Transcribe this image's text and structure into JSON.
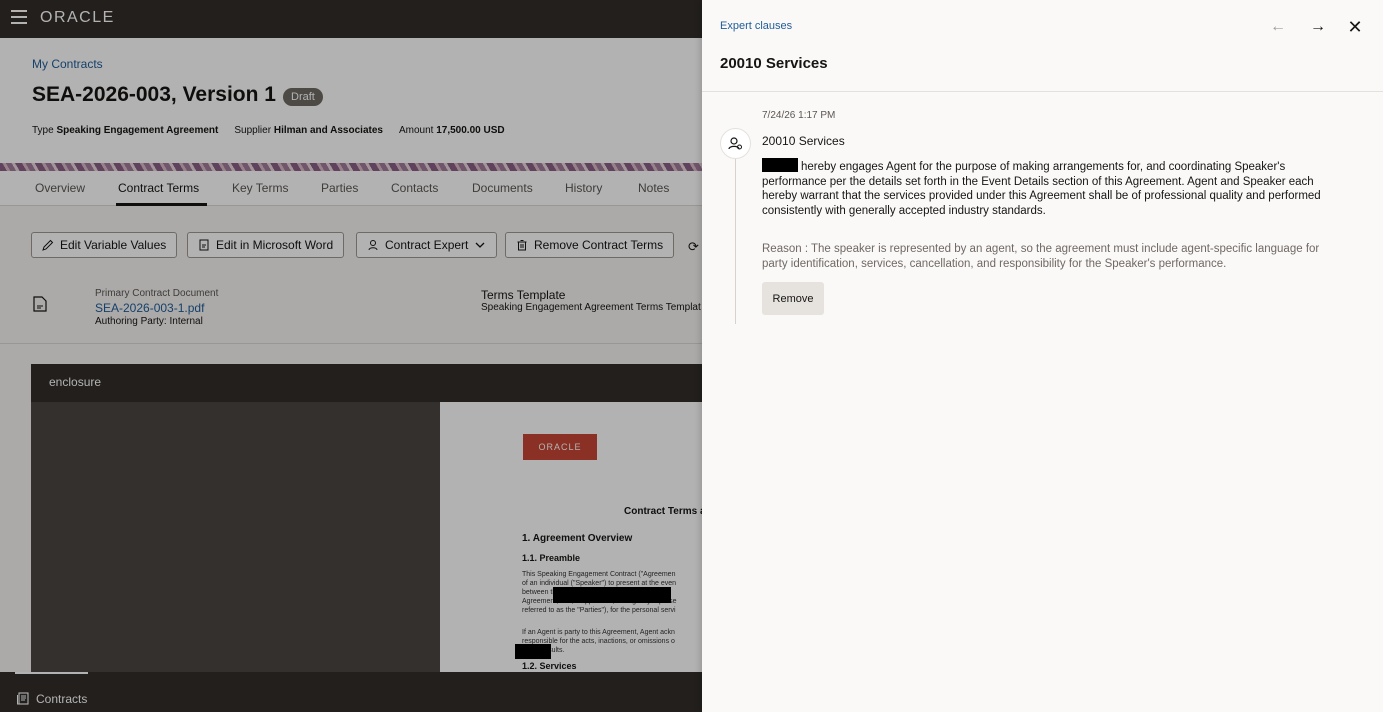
{
  "topbar": {
    "logo": "ORACLE"
  },
  "header": {
    "breadcrumb": "My Contracts",
    "title": "SEA-2026-003, Version 1",
    "status": "Draft",
    "meta": {
      "type_label": "Type",
      "type_value": "Speaking Engagement Agreement",
      "supplier_label": "Supplier",
      "supplier_value": "Hilman and Associates",
      "amount_label": "Amount",
      "amount_value": "17,500.00 USD"
    }
  },
  "tabs": [
    {
      "label": "Overview"
    },
    {
      "label": "Contract Terms",
      "active": true
    },
    {
      "label": "Key Terms"
    },
    {
      "label": "Parties"
    },
    {
      "label": "Contacts"
    },
    {
      "label": "Documents"
    },
    {
      "label": "History"
    },
    {
      "label": "Notes"
    }
  ],
  "toolbar": {
    "edit_variables": "Edit Variable Values",
    "edit_word": "Edit in Microsoft Word",
    "contract_expert": "Contract Expert",
    "remove_terms": "Remove Contract Terms"
  },
  "document": {
    "primary_label": "Primary Contract Document",
    "file_name": "SEA-2026-003-1.pdf",
    "authoring": "Authoring Party: Internal",
    "template_label": "Terms Template",
    "template_value": "Speaking Engagement Agreement Terms Templat"
  },
  "viewer": {
    "title": "enclosure",
    "logo": "ORACLE",
    "heading": "Contract Terms a",
    "section1": "1. Agreement Overview",
    "section1_1": "1.1. Preamble",
    "para1": [
      "This Speaking Engagement Contract (\"Agreemen",
      "of an individual (\"Speaker\") to present at the even",
      "between                                          the indiv",
      "Agreement, and, if applicable, the agency represe",
      "referred to as the \"Parties\"), for the personal servi"
    ],
    "para2": [
      "If an Agent is party to this Agreement, Agent ackn",
      "responsible for the acts, inactions, or omissions o",
      "              which results."
    ],
    "section1_2": "1.2. Services"
  },
  "bottom_bar": {
    "label": "Contracts"
  },
  "drawer": {
    "subtitle": "Expert clauses",
    "title": "20010 Services",
    "timestamp": "7/24/26 1:17 PM",
    "clause_title": "20010 Services",
    "clause_body": "hereby engages Agent for the purpose of making arrangements for, and coordinating Speaker's performance per the details set forth in the Event Details section of this Agreement. Agent and Speaker each hereby warrant that the services provided under this Agreement shall be of professional quality and performed consistently with generally accepted industry standards.",
    "reason": "Reason : The speaker is represented by an agent, so the agreement must include agent-specific language for party identification, services, cancellation, and responsibility for the Speaker's performance.",
    "remove_label": "Remove"
  },
  "icons": {
    "prev": "arrow-left-icon",
    "next": "arrow-right-icon",
    "close": "close-icon",
    "avatar": "expert-icon"
  },
  "colors": {
    "link": "#1f5c99",
    "dark_bar": "#312d2a",
    "brand_red": "#c74634",
    "badge": "#6f6964"
  }
}
